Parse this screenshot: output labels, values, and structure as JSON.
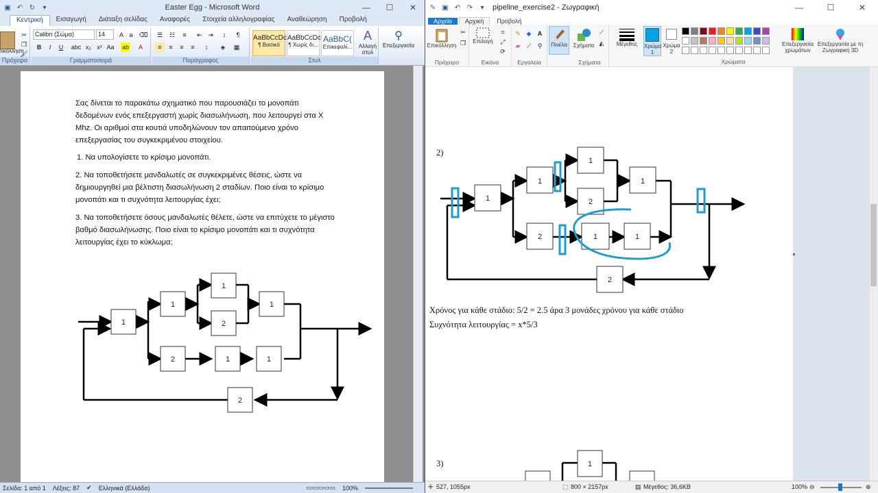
{
  "word": {
    "title": "Easter Egg - Microsoft Word",
    "tabs": [
      "Κεντρική",
      "Εισαγωγή",
      "Διάταξη σελίδας",
      "Αναφορές",
      "Στοιχεία αλληλογραφίας",
      "Αναθεώρηση",
      "Προβολή"
    ],
    "ribbon": {
      "paste_label": "Επικόλληση",
      "clipboard_group": "Πρόχειρο",
      "font_name": "Calibri (Σώμα)",
      "font_size": "14",
      "font_group": "Γραμματοσειρά",
      "paragraph_group": "Παράγραφος",
      "styles": [
        {
          "sample": "AaBbCcDc",
          "name": "¶ Βασικό"
        },
        {
          "sample": "AaBbCcDc",
          "name": "¶ Χωρίς δι..."
        },
        {
          "sample": "AaBbC(",
          "name": "Επικεφαλί..."
        }
      ],
      "style_group": "Στυλ",
      "change_styles": "Αλλαγή στυλ",
      "editing": "Επεξεργασία"
    },
    "doc": {
      "intro": "Σας δίνεται το παρακάτω σχηματικό που παρουσιάζει το μονοπάτι δεδομένων ενός επεξεργαστή χωρίς διασωλήνωση, που λειτουργεί στα X Mhz. Οι αριθμοί στα κουτιά υποδηλώνουν τον απαιτούμενο χρόνο επεξεργασίας του συγκεκριμένου στοιχείου.",
      "q1": "1. Να υπολογίσετε το κρίσιμο μονοπάτι.",
      "q2": "2. Να τοποθετήσετε μανδαλωτές σε συγκεκριμένες θέσεις, ώστε να δημιουργηθεί μια βέλτιστη διασωλήνωση 2 σταδίων. Ποιο είναι το κρίσιμο μονοπάτι και τι συχνότητα λειτουργίας έχει;",
      "q3": "3. Να τοποθετήσετε όσους μανδαλωτές θέλετε, ώστε να επιτύχετε το μέγιστο βαθμό διασωλήνωσης. Ποιο είναι το κρίσιμο μονοπάτι και τι συχνότητα λειτουργίας έχει το κύκλωμα;",
      "diagram": {
        "b1": "1",
        "b2": "1",
        "b3": "1",
        "b4": "2",
        "b5": "1",
        "b6": "2",
        "b7": "1",
        "b8": "1",
        "b9": "2"
      }
    },
    "status": {
      "page": "Σελίδα: 1 από 1",
      "words": "Λέξεις: 87",
      "language": "Ελληνικά (Ελλάδα)",
      "zoom": "100%"
    }
  },
  "paint": {
    "title": "pipeline_exercise2 - Ζωγραφική",
    "tabs": [
      "Αρχείο",
      "Αρχική",
      "Προβολή"
    ],
    "ribbon": {
      "paste": "Επικόλληση",
      "clipboard_group": "Πρόχειρο",
      "select": "Επιλογή",
      "image_group": "Εικόνα",
      "tools_group": "Εργαλεία",
      "brushes": "Πινέλα",
      "shapes": "Σχήματα",
      "shapes_group": "Σχήματα",
      "size": "Μέγεθος",
      "color1": "Χρώμα 1",
      "color2": "Χρώμα 2",
      "colors_group": "Χρώματα",
      "edit_colors": "Επεξεργασία χρωμάτων",
      "paint3d": "Επεξεργασία με τη Ζωγραφική 3D",
      "palette": [
        "#000000",
        "#7f7f7f",
        "#880015",
        "#ed1c24",
        "#ff7f27",
        "#fff200",
        "#22b14c",
        "#00a2e8",
        "#3f48cc",
        "#a349a4",
        "#ffffff",
        "#c3c3c3",
        "#b97a57",
        "#ffaec9",
        "#ffc90e",
        "#efe4b0",
        "#b5e61d",
        "#99d9ea",
        "#7092be",
        "#c8bfe7"
      ],
      "active_color": "#00a2e8"
    },
    "canvas": {
      "label2": "2)",
      "label3": "3)",
      "stage_time": "Χρόνος για κάθε στάδιο: 5/2 = 2.5 άρα 3 μονάδες χρόνου για κάθε στάδιο",
      "frequency": "Συχνότητα λειτουργίας = x*5/3",
      "diagram": {
        "b1": "1",
        "b2": "1",
        "b3": "1",
        "b4": "2",
        "b5": "1",
        "b6": "2",
        "b7": "1",
        "b8": "1",
        "b9": "2",
        "c1": "1"
      }
    },
    "status": {
      "coords": "527, 1055px",
      "dims": "800 × 2157px",
      "size": "Μέγεθος: 36,6KB",
      "zoom": "100%"
    }
  }
}
